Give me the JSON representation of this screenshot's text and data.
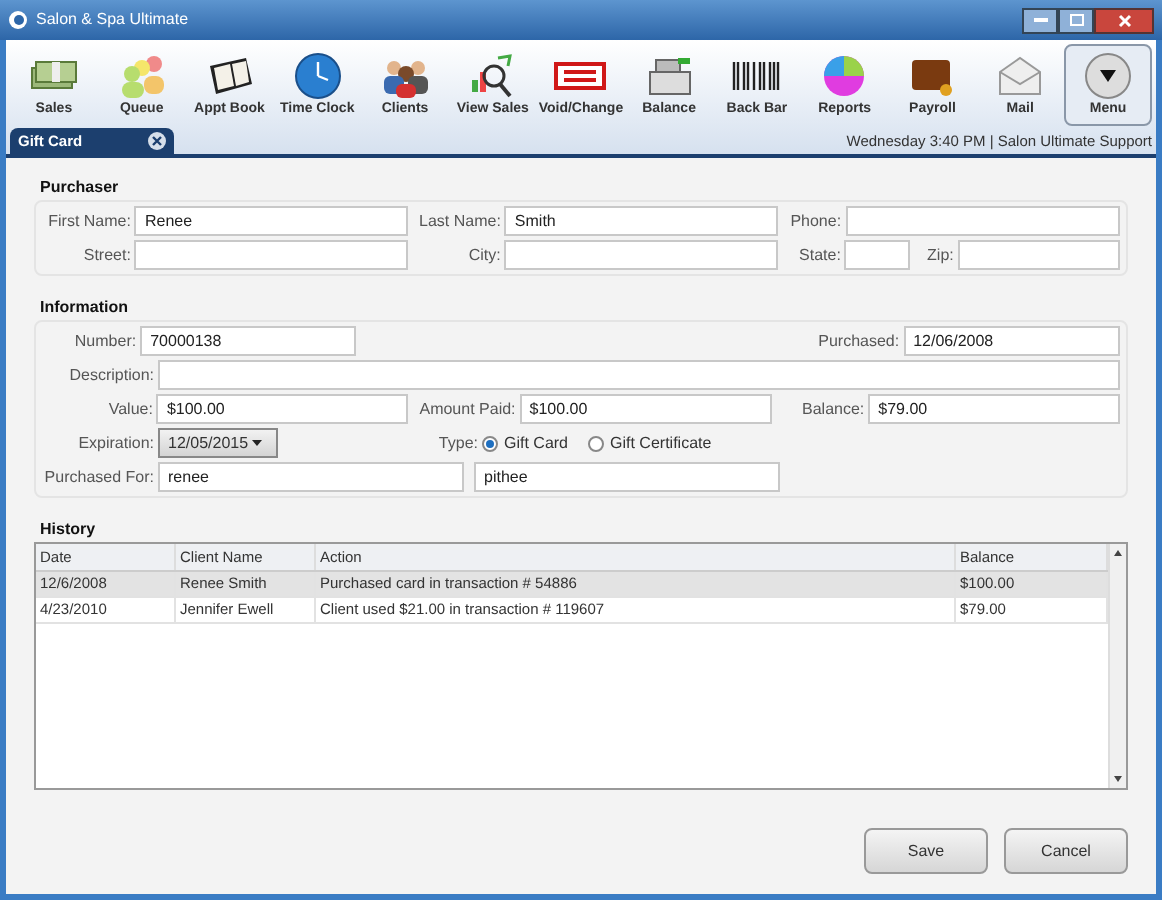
{
  "window": {
    "title": "Salon & Spa Ultimate"
  },
  "toolbar": [
    {
      "label": "Sales",
      "kind": "money",
      "selected": false
    },
    {
      "label": "Queue",
      "kind": "people",
      "selected": false
    },
    {
      "label": "Appt Book",
      "kind": "book",
      "selected": false
    },
    {
      "label": "Time Clock",
      "kind": "clock",
      "selected": false
    },
    {
      "label": "Clients",
      "kind": "clients",
      "selected": false
    },
    {
      "label": "View Sales",
      "kind": "chart",
      "selected": false
    },
    {
      "label": "Void/Change",
      "kind": "void",
      "selected": false
    },
    {
      "label": "Balance",
      "kind": "register",
      "selected": false
    },
    {
      "label": "Back Bar",
      "kind": "barcode",
      "selected": false
    },
    {
      "label": "Reports",
      "kind": "pie",
      "selected": false
    },
    {
      "label": "Payroll",
      "kind": "wallet",
      "selected": false
    },
    {
      "label": "Mail",
      "kind": "mail",
      "selected": false
    },
    {
      "label": "Menu",
      "kind": "menu",
      "selected": true
    }
  ],
  "tabs": [
    {
      "label": "Gift Card",
      "selected": true
    }
  ],
  "status": "Wednesday 3:40 PM | Salon Ultimate Support",
  "purchaser": {
    "title": "Purchaser",
    "first_name": {
      "label": "First Name:",
      "value": "Renee"
    },
    "last_name": {
      "label": "Last Name:",
      "value": "Smith"
    },
    "phone": {
      "label": "Phone:"
    },
    "street": {
      "label": "Street:"
    },
    "city": {
      "label": "City:"
    },
    "state": {
      "label": "State:"
    },
    "zip": {
      "label": "Zip:"
    }
  },
  "information": {
    "title": "Information",
    "number": {
      "label": "Number:",
      "value": "70000138"
    },
    "purchased": {
      "label": "Purchased:",
      "value": "12/06/2008"
    },
    "description": {
      "label": "Description:"
    },
    "value": {
      "label": "Value:",
      "value": "$100.00"
    },
    "amount_paid": {
      "label": "Amount Paid:",
      "value": "$100.00"
    },
    "balance": {
      "label": "Balance:",
      "value": "$79.00"
    },
    "expiration": {
      "label": "Expiration:",
      "value": "12/05/2015"
    },
    "type": {
      "label": "Type:",
      "options": [
        {
          "label": "Gift Card",
          "selected": true
        },
        {
          "label": "Gift Certificate",
          "selected": false
        }
      ]
    },
    "purchased_for": {
      "label": "Purchased For:",
      "first": "renee",
      "last": "pithee"
    }
  },
  "history": {
    "title": "History",
    "columns": [
      "Date",
      "Client Name",
      "Action",
      "Balance"
    ],
    "rows": [
      {
        "cells": [
          "12/6/2008",
          "Renee Smith",
          "Purchased card in transaction # 54886",
          "$100.00"
        ],
        "selected": true
      },
      {
        "cells": [
          "4/23/2010",
          "Jennifer Ewell",
          "Client used $21.00 in transaction # 119607",
          "$79.00"
        ],
        "selected": false
      }
    ]
  },
  "buttons": [
    "Save",
    "Cancel"
  ]
}
